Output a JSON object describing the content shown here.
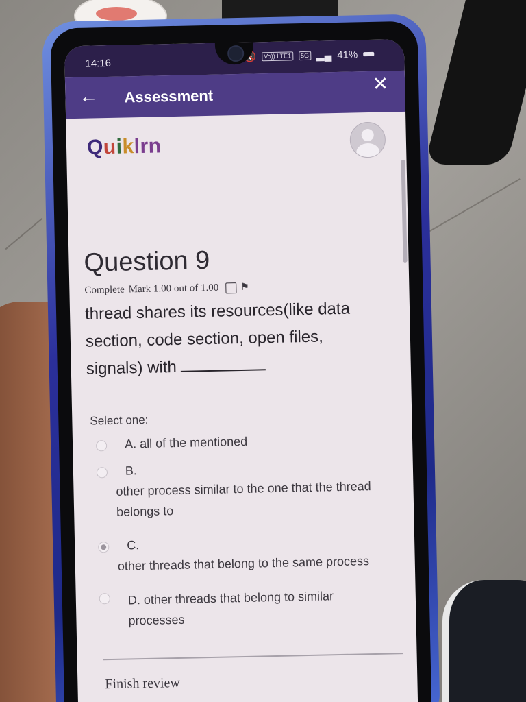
{
  "status_bar": {
    "time": "14:16",
    "network": "Vo)) LTE1",
    "network_type": "5G",
    "battery": "41%"
  },
  "app_bar": {
    "title": "Assessment",
    "back_icon": "arrow-left",
    "close_icon": "x"
  },
  "brand": {
    "logo_q": "Q",
    "logo_u": "u",
    "logo_i": "i",
    "logo_k": "k",
    "logo_rest": "lrn"
  },
  "question": {
    "title": "Question 9",
    "status": "Complete",
    "mark": "Mark 1.00 out of 1.00",
    "text": "thread shares its resources(like data section, code section, open files, signals) with"
  },
  "answer": {
    "prompt": "Select one:",
    "selected_index": 2,
    "options": [
      {
        "letter": "A.",
        "text": "all of the mentioned"
      },
      {
        "letter": "B.",
        "text": "other process similar to the one that the thread belongs to"
      },
      {
        "letter": "C.",
        "text": "other threads that belong to the same process"
      },
      {
        "letter": "D.",
        "text": "other threads that belong to similar processes"
      }
    ]
  },
  "footer": {
    "finish_label": "Finish review"
  },
  "colors": {
    "app_bar": "#4e3c86",
    "status_bar": "#2c1f4a",
    "screen_bg": "#ece5ea"
  }
}
